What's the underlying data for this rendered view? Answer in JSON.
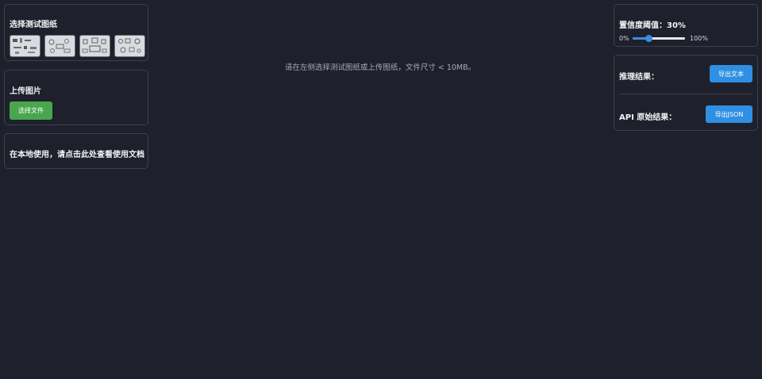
{
  "left": {
    "select_title": "选择测试图纸",
    "thumbnails": [
      "test-drawing-1",
      "test-drawing-2",
      "test-drawing-3",
      "test-drawing-4"
    ],
    "upload_title": "上传图片",
    "upload_button": "选择文件",
    "docs_link": "在本地使用，请点击此处查看使用文档"
  },
  "main": {
    "hint": "请在左侧选择测试图纸或上传图纸，文件尺寸 < 10MB。"
  },
  "right": {
    "confidence_label": "置信度阈值：30%",
    "confidence_value": 0.3,
    "range_min": "0%",
    "range_max": "100%",
    "result_label": "推理结果：",
    "export_text_button": "导出文本",
    "api_label": "API 原始结果：",
    "export_json_button": "导出JSON"
  },
  "colors": {
    "background": "#1e212b",
    "panel_border": "#3c404c",
    "upload_button": "#4aa64d",
    "export_button": "#2f8fe3",
    "slider_accent": "#3b8fe0"
  }
}
